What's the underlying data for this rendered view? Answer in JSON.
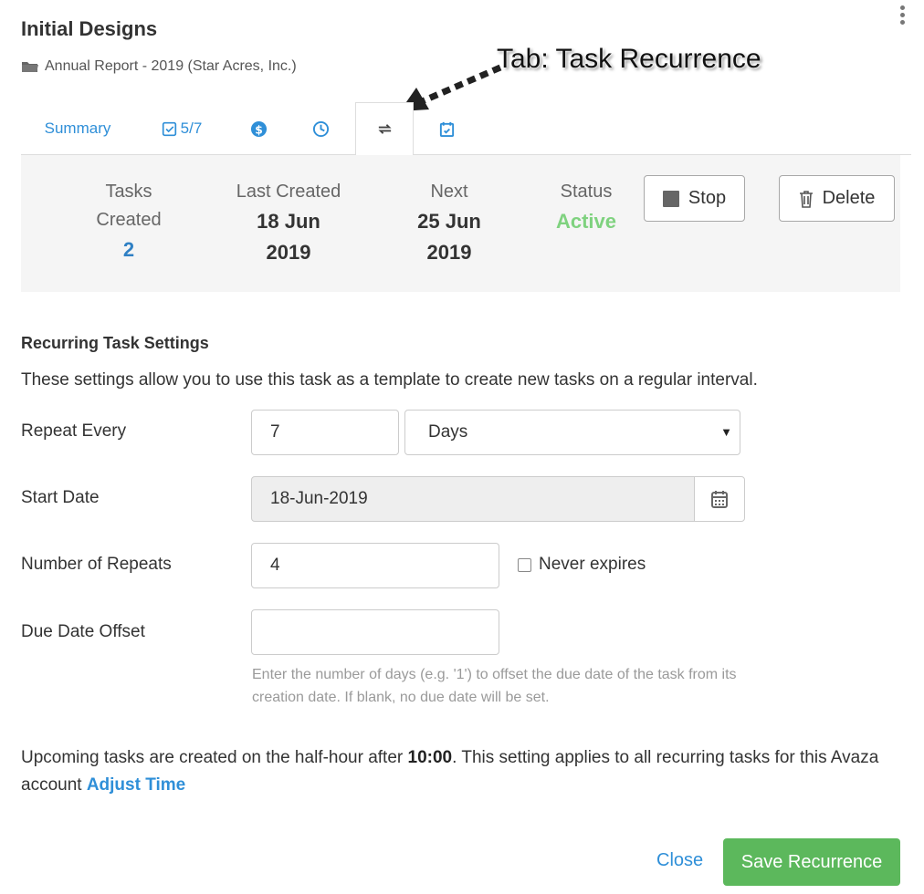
{
  "header": {
    "title": "Initial Designs",
    "project": "Annual Report - 2019 (Star Acres, Inc.)"
  },
  "annotation": "Tab: Task Recurrence",
  "tabs": {
    "summary": "Summary",
    "checklist": "5/7",
    "icons": [
      "checklist-icon",
      "dollar-icon",
      "clock-icon",
      "recurrence-icon",
      "calendar-check-icon"
    ]
  },
  "stats": {
    "tasks_created_label": "Tasks Created",
    "tasks_created_value": "2",
    "last_created_label": "Last Created",
    "last_created_value": "18 Jun 2019",
    "next_label": "Next",
    "next_value": "25 Jun 2019",
    "status_label": "Status",
    "status_value": "Active",
    "stop_label": "Stop",
    "delete_label": "Delete"
  },
  "settings": {
    "heading": "Recurring Task Settings",
    "description": "These settings allow you to use this task as a template to create new tasks on a regular interval.",
    "repeat_every_label": "Repeat Every",
    "repeat_every_value": "7",
    "repeat_unit_value": "Days",
    "start_date_label": "Start Date",
    "start_date_value": "18-Jun-2019",
    "number_of_repeats_label": "Number of Repeats",
    "number_of_repeats_value": "4",
    "never_expires_label": "Never expires",
    "never_expires_checked": false,
    "due_date_offset_label": "Due Date Offset",
    "due_date_offset_value": "",
    "due_date_help": "Enter the number of days (e.g. '1') to offset the due date of the task from its creation date. If blank, no due date will be set."
  },
  "note": {
    "before": "Upcoming tasks are created on the half-hour after ",
    "time": "10:00",
    "after": ". This setting applies to all recurring tasks for this Avaza account ",
    "link": "Adjust Time"
  },
  "footer": {
    "close_label": "Close",
    "save_label": "Save Recurrence"
  },
  "colors": {
    "link_blue": "#2f8fd8",
    "status_green": "#7fd27f",
    "save_green": "#5cb85c",
    "stat_blue": "#2f80c4"
  }
}
